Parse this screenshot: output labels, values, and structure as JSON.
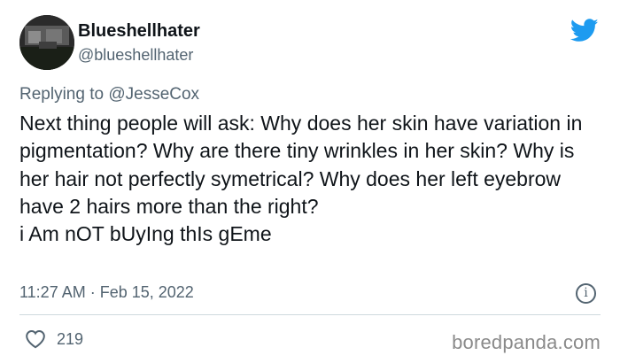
{
  "user": {
    "display_name": "Blueshellhater",
    "handle": "@blueshellhater",
    "avatar_icon": "avatar-photo-icon"
  },
  "reply": {
    "prefix": "Replying to ",
    "mention": "@JesseCox"
  },
  "tweet": {
    "text": "Next thing people will ask: Why does her skin have variation in pigmentation? Why are there tiny wrinkles in her skin? Why is her hair not perfectly symetrical? Why does her left eyebrow have 2 hairs more than the right?\ni Am nOT bUyIng thIs gEme",
    "timestamp": "11:27 AM · Feb 15, 2022",
    "likes": "219"
  },
  "icons": {
    "brand": "twitter-bird-icon",
    "info": "info-icon",
    "like": "heart-icon"
  },
  "colors": {
    "brand_blue": "#1d9bf0",
    "secondary_text": "#536471",
    "divider": "#cfd9de"
  },
  "watermark": "boredpanda.com"
}
